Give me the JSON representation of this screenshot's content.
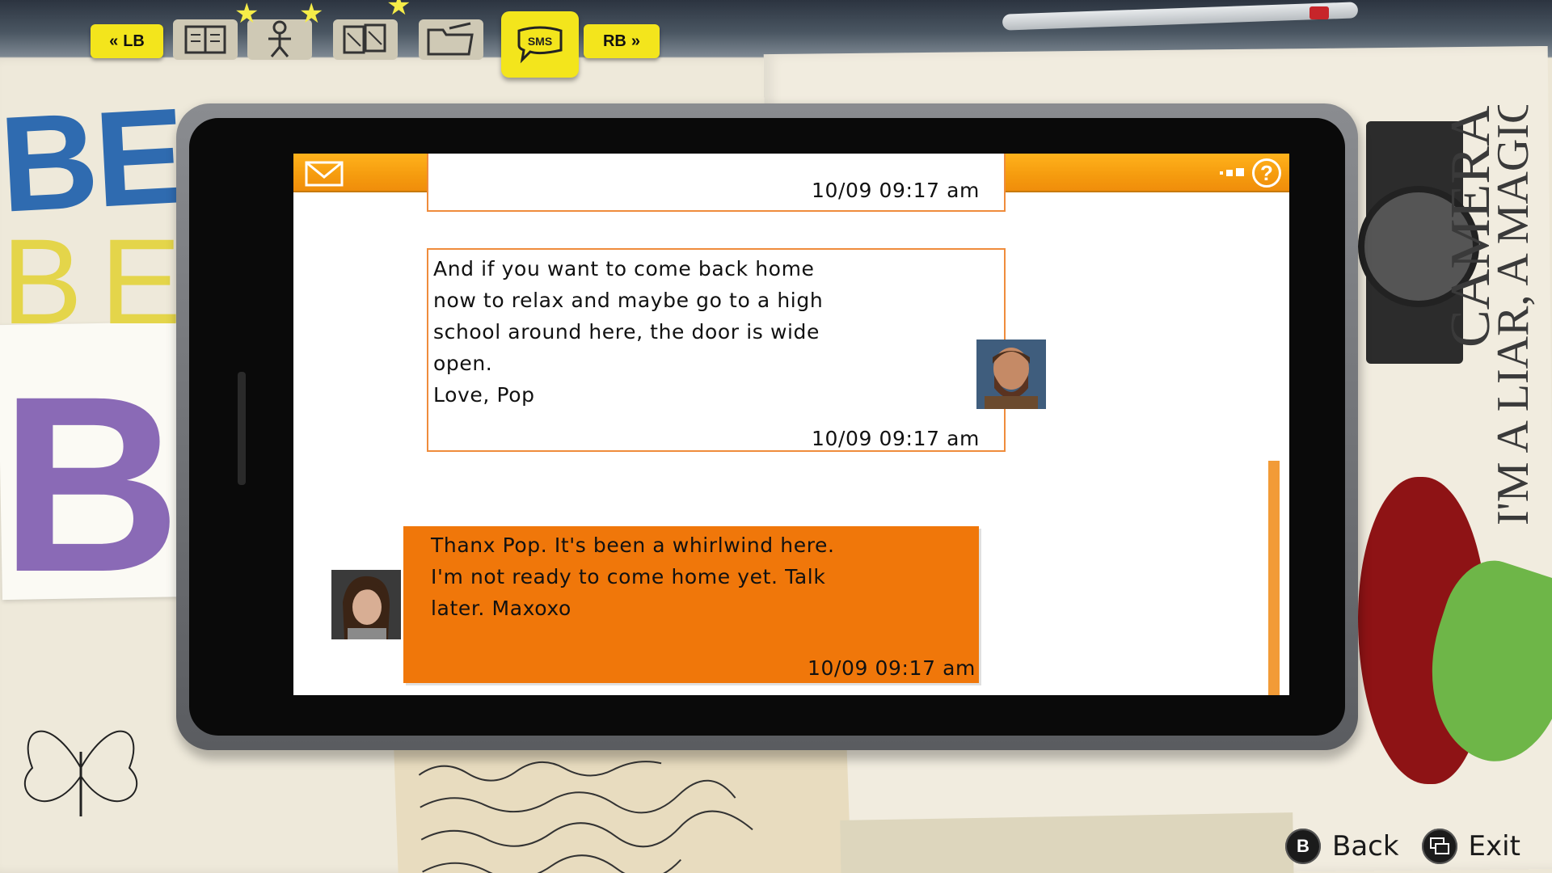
{
  "tabs": {
    "left_bumper": "LB",
    "right_bumper": "RB",
    "active_tab": "SMS",
    "items": [
      {
        "icon": "journal-icon"
      },
      {
        "icon": "character-icon"
      },
      {
        "icon": "photos-icon"
      },
      {
        "icon": "folder-icon"
      },
      {
        "icon": "sms-icon",
        "label": "SMS"
      }
    ]
  },
  "phone": {
    "header": {
      "mail_icon": "envelope-icon",
      "signal_icon": "signal-icon",
      "help_label": "?"
    },
    "messages": [
      {
        "sender": "Pop",
        "direction": "incoming",
        "text": "",
        "time": "10/09  09:17 am"
      },
      {
        "sender": "Pop",
        "direction": "incoming",
        "text": "And if you want to come back home\nnow to relax and maybe go to a high\nschool around here, the door is wide\nopen.\nLove, Pop",
        "time": "10/09  09:17 am"
      },
      {
        "sender": "Max",
        "direction": "outgoing",
        "text": "Thanx Pop. It's been a whirlwind here.\nI'm not ready to come home yet. Talk\nlater. Maxoxo",
        "time": "10/09  09:17 am"
      }
    ]
  },
  "footer": {
    "back_button": "B",
    "back_label": "Back",
    "exit_label": "Exit"
  },
  "colors": {
    "accent_yellow": "#f3e51c",
    "header_orange": "#f59b0e",
    "outgoing_bubble": "#f0770a",
    "incoming_border": "#ef8c3c"
  }
}
